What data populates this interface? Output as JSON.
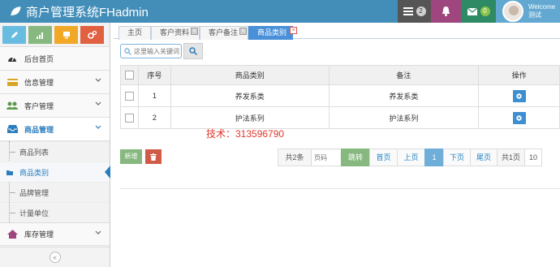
{
  "header": {
    "brand": "商户管理系统FHadmin",
    "messages_count": "2",
    "mail_count": "0",
    "welcome": "Welcome",
    "username": "测试"
  },
  "colors": {
    "navbar": "#438eb9",
    "accent": "#2b7dbc",
    "watermark": "#e0362b"
  },
  "sidebar": {
    "menu": [
      {
        "label": "后台首页",
        "icon": "tachometer-icon"
      },
      {
        "label": "信息管理",
        "icon": "credit-card-icon"
      },
      {
        "label": "客户管理",
        "icon": "users-icon"
      },
      {
        "label": "商品管理",
        "icon": "inbox-icon"
      }
    ],
    "submenu": [
      {
        "label": "商品列表"
      },
      {
        "label": "商品类别"
      },
      {
        "label": "品牌管理"
      },
      {
        "label": "计量单位"
      }
    ],
    "stock": {
      "label": "库存管理",
      "icon": "home-icon"
    },
    "collapse_glyph": "«"
  },
  "tabs": [
    {
      "label": "主页"
    },
    {
      "label": "客户资料"
    },
    {
      "label": "客户备注"
    },
    {
      "label": "商品类别"
    }
  ],
  "search": {
    "placeholder": "这里输入关键词"
  },
  "table": {
    "headers": [
      "",
      "序号",
      "商品类别",
      "备注",
      "操作"
    ],
    "rows": [
      {
        "index": "1",
        "category": "养发系类",
        "remark": "养发系类"
      },
      {
        "index": "2",
        "category": "护法系列",
        "remark": "护法系列"
      }
    ]
  },
  "watermark": "技术：313596790",
  "actions": {
    "new_label": "新增"
  },
  "pagination": {
    "total": "共2条",
    "page_input_placeholder": "页码",
    "go": "跳转",
    "first": "首页",
    "prev": "上页",
    "current": "1",
    "next": "下页",
    "last": "尾页",
    "page_count": "共1页",
    "page_size": "10"
  }
}
